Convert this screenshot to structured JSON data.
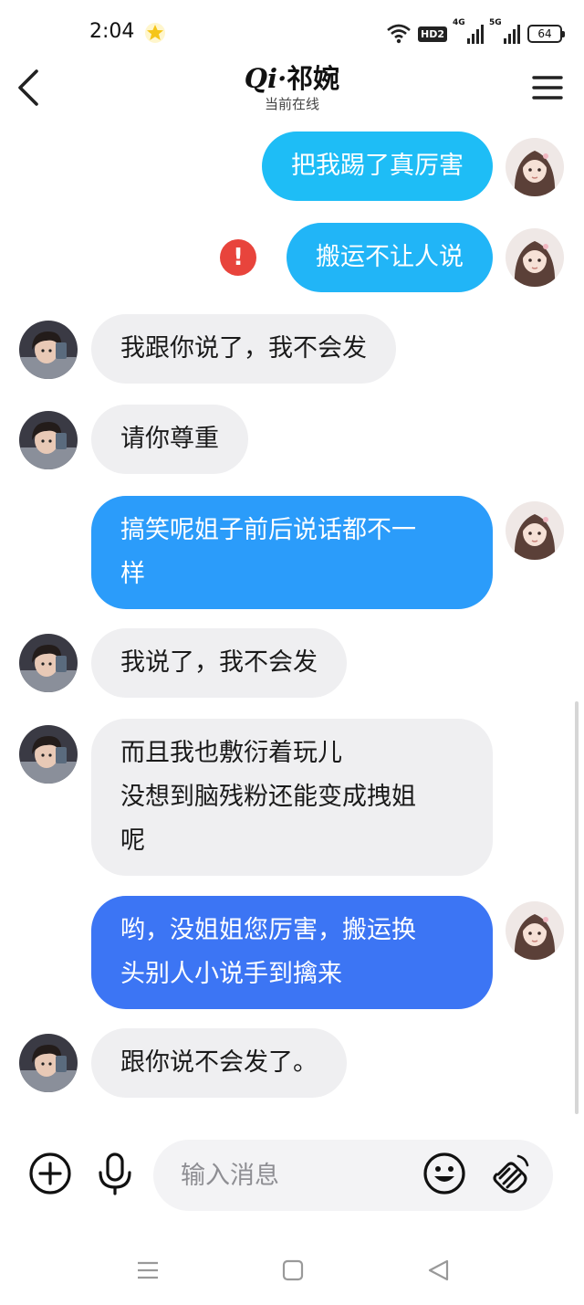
{
  "status_bar": {
    "time": "2:04",
    "hd_badge": "HD2",
    "signal1_label": "4G",
    "signal2_label": "5G",
    "battery": "64"
  },
  "header": {
    "title_prefix": "Qi·",
    "title_name": "祁婉",
    "subtitle": "当前在线",
    "back_icon": "chevron-left-icon",
    "menu_icon": "hamburger-menu-icon"
  },
  "colors": {
    "bubble_incoming": "#efeff1",
    "bubble_out_1": "#1ebdf6",
    "bubble_out_2": "#2b9cfa",
    "bubble_out_3": "#3c75f4",
    "error_red": "#e8443c",
    "star_gold": "#f5c518"
  },
  "messages": [
    {
      "side": "out",
      "text": "把我踢了真厉害",
      "error": false
    },
    {
      "side": "out",
      "text": "搬运不让人说",
      "error": true
    },
    {
      "side": "in",
      "text": "我跟你说了，我不会发"
    },
    {
      "side": "in",
      "text": "请你尊重"
    },
    {
      "side": "out",
      "text": "搞笑呢姐子前后说话都不一\n样",
      "error": false
    },
    {
      "side": "in",
      "text": "我说了，我不会发"
    },
    {
      "side": "in",
      "text": "而且我也敷衍着玩儿\n没想到脑残粉还能变成拽姐\n呢"
    },
    {
      "side": "out",
      "text": "哟，没姐姐您厉害，搬运换\n头别人小说手到擒来",
      "error": false
    },
    {
      "side": "in",
      "text": "跟你说不会发了。"
    }
  ],
  "input_bar": {
    "placeholder": "输入消息",
    "plus_icon": "plus-circle-icon",
    "mic_icon": "microphone-icon",
    "emoji_icon": "smiley-icon",
    "gesture_icon": "hand-wave-icon"
  },
  "nav_bar": {
    "menu_icon": "nav-recents-icon",
    "home_icon": "nav-home-icon",
    "back_icon": "nav-back-icon"
  }
}
